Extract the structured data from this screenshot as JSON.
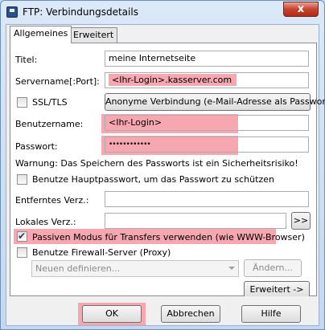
{
  "window": {
    "title": "FTP: Verbindungsdetails",
    "close_glyph": "x"
  },
  "tabs": [
    {
      "label": "Allgemeines"
    },
    {
      "label": "Erweitert"
    }
  ],
  "form": {
    "titel_label": "Titel:",
    "titel_value": "meine Internetseite",
    "server_label": "Servername[:Port]:",
    "server_value": "<Ihr-Login>.kasserver.com",
    "ssl_label": "SSL/TLS",
    "anon_button": "Anonyme Verbindung (e-Mail-Adresse als Passwort)",
    "user_label": "Benutzername:",
    "user_value": "<Ihr-Login>",
    "pass_label": "Passwort:",
    "pass_value": "••••••••••••",
    "warning": "Warnung: Das Speichern des Passworts ist ein Sicherheitsrisiko!",
    "master_label": "Benutze Hauptpasswort, um das Passwort zu schützen",
    "remote_label": "Entferntes Verz.:",
    "remote_value": "",
    "local_label": "Lokales Verz.:",
    "local_value": "",
    "browse_button": ">>",
    "passive_label": "Passiven Modus für Transfers verwenden (wie WWW-Browser)",
    "passive_checked": true,
    "firewall_label": "Benutze Firewall-Server (Proxy)",
    "firewall_select": "Neuen definieren...",
    "aendern_button": "Ändern...",
    "erweitert_button": "Erweitert ->"
  },
  "footer": {
    "ok": "OK",
    "cancel": "Abbrechen",
    "help": "Hilfe"
  }
}
